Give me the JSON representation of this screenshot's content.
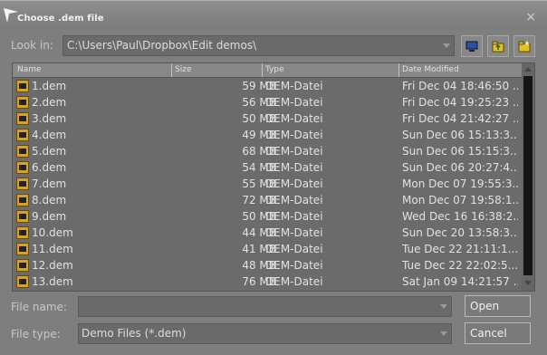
{
  "window": {
    "title": "Choose .dem file",
    "close_glyph": "×"
  },
  "look_in": {
    "label": "Look in:",
    "value": "C:\\Users\\Paul\\Dropbox\\Edit demos\\"
  },
  "toolbar": {
    "icons": [
      "desktop-icon",
      "up-folder-icon",
      "new-folder-icon"
    ]
  },
  "columns": [
    "Name",
    "Size",
    "Type",
    "Date Modified"
  ],
  "files": [
    {
      "name": "1.dem",
      "size": "59 MB",
      "type": "DEM-Datei",
      "date": "Fri Dec 04 18:46:50 ..."
    },
    {
      "name": "2.dem",
      "size": "56 MB",
      "type": "DEM-Datei",
      "date": "Fri Dec 04 19:25:23 ..."
    },
    {
      "name": "3.dem",
      "size": "50 MB",
      "type": "DEM-Datei",
      "date": "Fri Dec 04 21:42:27 ..."
    },
    {
      "name": "4.dem",
      "size": "49 MB",
      "type": "DEM-Datei",
      "date": "Sun Dec 06 15:13:3..."
    },
    {
      "name": "5.dem",
      "size": "68 MB",
      "type": "DEM-Datei",
      "date": "Sun Dec 06 15:15:3..."
    },
    {
      "name": "6.dem",
      "size": "54 MB",
      "type": "DEM-Datei",
      "date": "Sun Dec 06 20:27:4..."
    },
    {
      "name": "7.dem",
      "size": "55 MB",
      "type": "DEM-Datei",
      "date": "Mon Dec 07 19:55:3..."
    },
    {
      "name": "8.dem",
      "size": "72 MB",
      "type": "DEM-Datei",
      "date": "Mon Dec 07 19:58:1..."
    },
    {
      "name": "9.dem",
      "size": "50 MB",
      "type": "DEM-Datei",
      "date": "Wed Dec 16 16:38:2..."
    },
    {
      "name": "10.dem",
      "size": "44 MB",
      "type": "DEM-Datei",
      "date": "Sun Dec 20 13:58:3..."
    },
    {
      "name": "11.dem",
      "size": "41 MB",
      "type": "DEM-Datei",
      "date": "Tue Dec 22 21:11:1..."
    },
    {
      "name": "12.dem",
      "size": "48 MB",
      "type": "DEM-Datei",
      "date": "Tue Dec 22 22:02:5..."
    },
    {
      "name": "13.dem",
      "size": "76 MB",
      "type": "DEM-Datei",
      "date": "Sat Jan 09 14:21:57 ..."
    }
  ],
  "file_name": {
    "label": "File name:",
    "value": ""
  },
  "file_type": {
    "label": "File type:",
    "value": "Demo Files (*.dem)"
  },
  "buttons": {
    "open": "Open",
    "cancel": "Cancel"
  },
  "colors": {
    "background": "#7e7e7e",
    "list_bg": "#6b6b6b",
    "file_icon": "#d3a22c"
  }
}
